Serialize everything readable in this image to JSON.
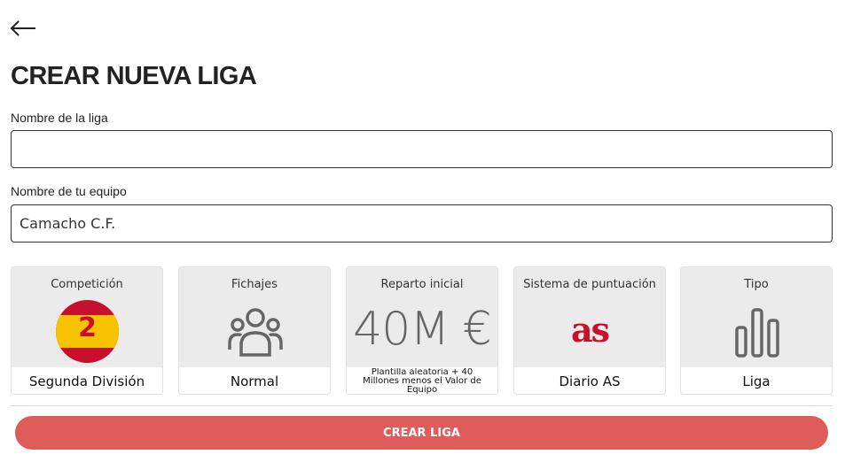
{
  "header": {
    "back_icon": "arrow-left-icon",
    "title": "CREAR NUEVA LIGA"
  },
  "form": {
    "league_name": {
      "label": "Nombre de la liga",
      "value": "",
      "placeholder": ""
    },
    "team_name": {
      "label": "Nombre de tu equipo",
      "value": "Camacho C.F."
    }
  },
  "options": [
    {
      "title": "Competición",
      "value": "Segunda División",
      "icon": "spain-flag-icon",
      "icon_text": "2"
    },
    {
      "title": "Fichajes",
      "value": "Normal",
      "icon": "users-icon"
    },
    {
      "title": "Reparto inicial",
      "value": "Plantilla aleatoria + 40 Millones menos el Valor de Equipo",
      "icon_text": "40M €"
    },
    {
      "title": "Sistema de puntuación",
      "value": "Diario AS",
      "icon": "as-logo-icon",
      "icon_text": "as"
    },
    {
      "title": "Tipo",
      "value": "Liga",
      "icon": "bar-chart-icon"
    }
  ],
  "submit": {
    "label": "CREAR LIGA"
  },
  "colors": {
    "accent": "#de5c5a",
    "brand_red": "#c8102e",
    "flag_yellow": "#f7c300",
    "card_bg": "#ebebeb",
    "icon_gray": "#666666"
  }
}
